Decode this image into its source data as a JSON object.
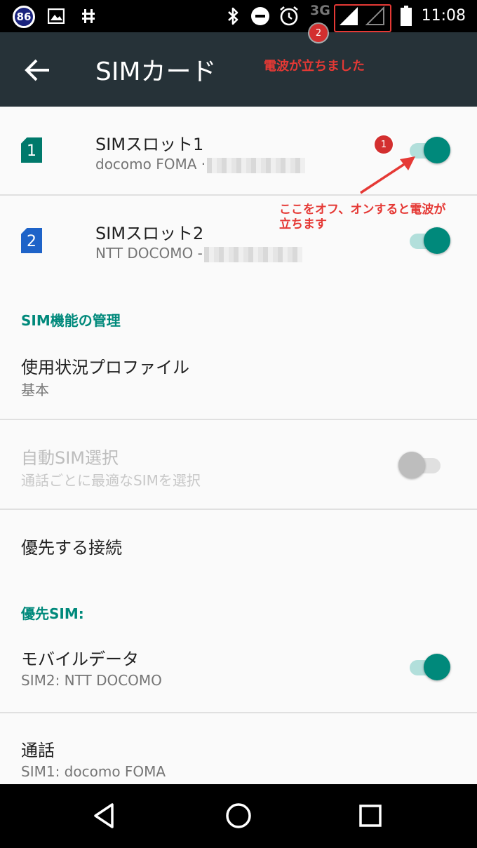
{
  "status_bar": {
    "notification_count": "86",
    "network_type": "3G",
    "time": "11:08"
  },
  "app_bar": {
    "title": "SIMカード"
  },
  "sim_slots": [
    {
      "slot_number": "1",
      "title": "SIMスロット1",
      "subtitle": "docomo FOMA ·",
      "enabled": true,
      "icon_color": "#00796b"
    },
    {
      "slot_number": "2",
      "title": "SIMスロット2",
      "subtitle": "NTT DOCOMO -",
      "enabled": true,
      "icon_color": "#1e63c8"
    }
  ],
  "sections": {
    "management_header": "SIM機能の管理",
    "usage_profile": {
      "title": "使用状況プロファイル",
      "subtitle": "基本"
    },
    "auto_sim": {
      "title": "自動SIM選択",
      "subtitle": "通話ごとに最適なSIMを選択",
      "enabled": false,
      "disabled": true
    },
    "preferred_connection": {
      "title": "優先する接続"
    },
    "preferred_sim_header": "優先SIM:",
    "mobile_data": {
      "title": "モバイルデータ",
      "subtitle": "SIM2: NTT DOCOMO",
      "enabled": true
    },
    "calls": {
      "title": "通話",
      "subtitle": "SIM1: docomo FOMA"
    }
  },
  "annotations": {
    "badge_1": "1",
    "badge_2": "2",
    "signal_note": "電波が立ちました",
    "toggle_note_line1": "ここをオフ、オンすると電波が",
    "toggle_note_line2": "立ちます",
    "color": "#e53935"
  },
  "colors": {
    "accent": "#00897b",
    "app_bar": "#263238",
    "status_bar": "#000000"
  }
}
